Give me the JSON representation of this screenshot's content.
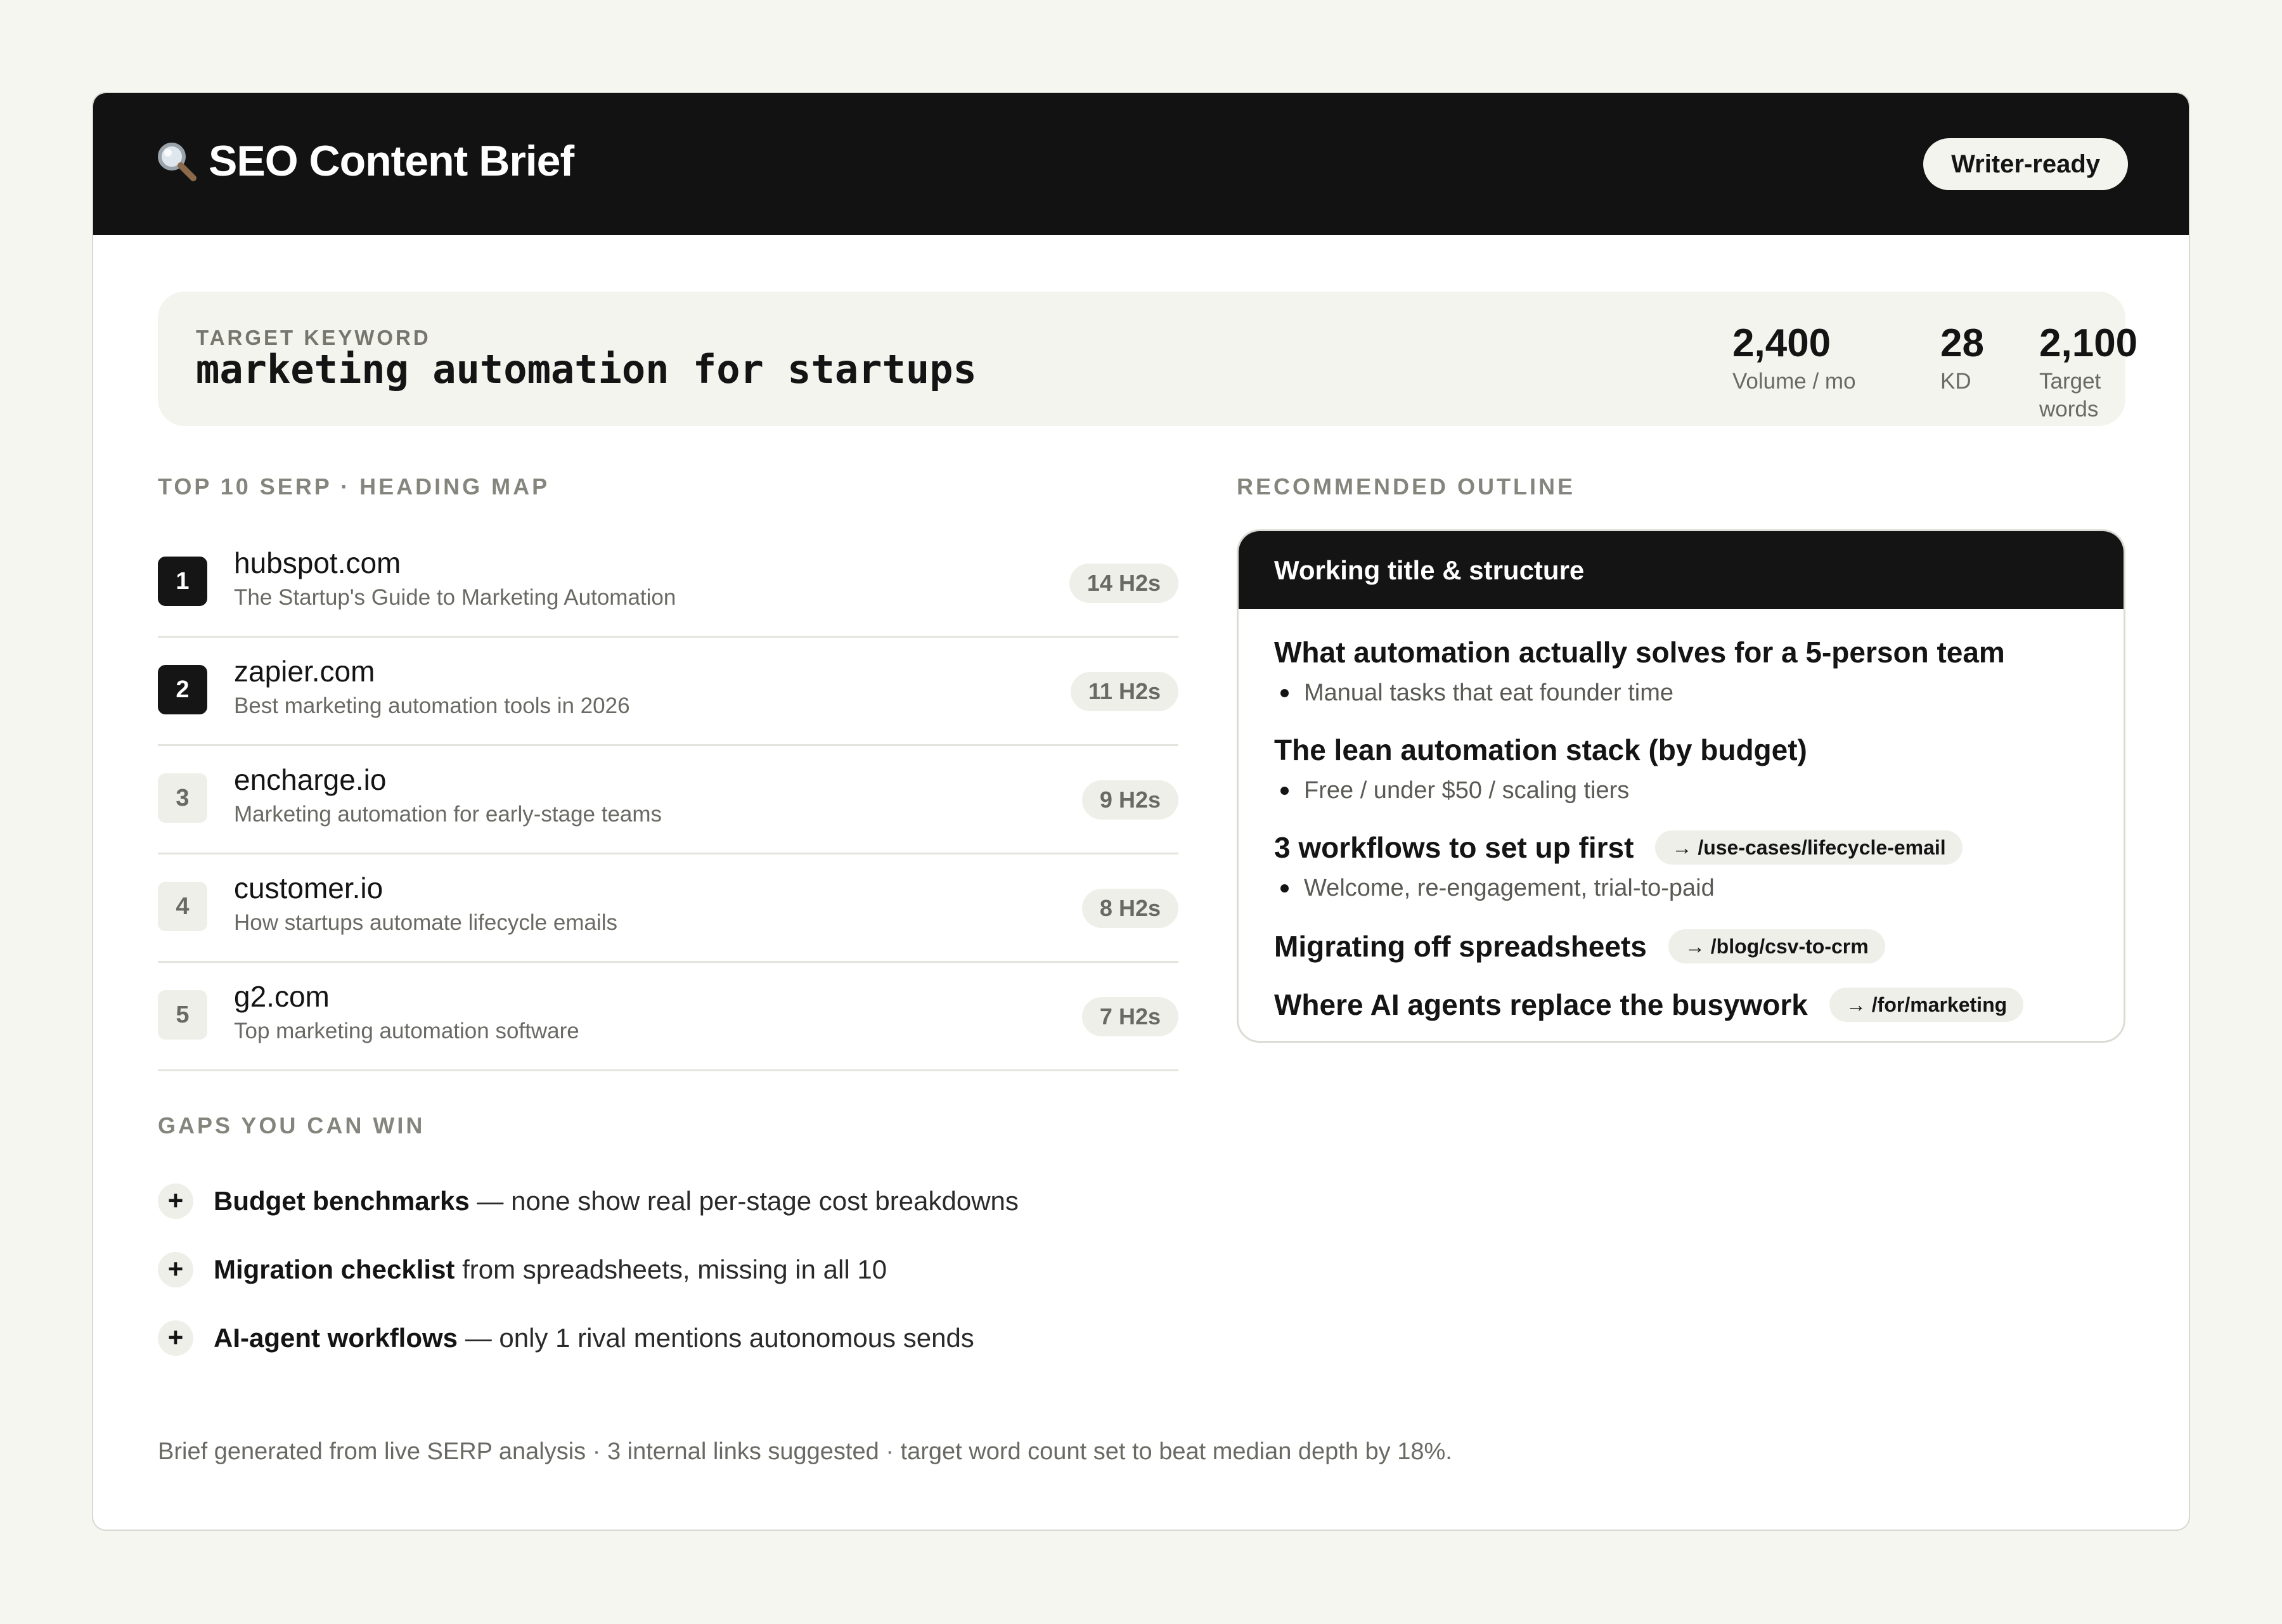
{
  "header": {
    "title": "SEO Content Brief",
    "icon": "magnifier-icon",
    "status_badge": "Writer-ready"
  },
  "keyword": {
    "label": "TARGET KEYWORD",
    "value": "marketing automation for startups",
    "metrics": [
      {
        "value": "2,400",
        "label": "Volume / mo"
      },
      {
        "value": "28",
        "label": "KD"
      },
      {
        "value": "2,100",
        "label": "Target words"
      }
    ]
  },
  "serp": {
    "section_label": "TOP 10 SERP · HEADING MAP",
    "rows": [
      {
        "rank": "1",
        "domain": "hubspot.com",
        "title": "The Startup's Guide to Marketing Automation",
        "h2s": "14 H2s",
        "highlight": true
      },
      {
        "rank": "2",
        "domain": "zapier.com",
        "title": "Best marketing automation tools in 2026",
        "h2s": "11 H2s",
        "highlight": true
      },
      {
        "rank": "3",
        "domain": "encharge.io",
        "title": "Marketing automation for early-stage teams",
        "h2s": "9 H2s",
        "highlight": false
      },
      {
        "rank": "4",
        "domain": "customer.io",
        "title": "How startups automate lifecycle emails",
        "h2s": "8 H2s",
        "highlight": false
      },
      {
        "rank": "5",
        "domain": "g2.com",
        "title": "Top marketing automation software",
        "h2s": "7 H2s",
        "highlight": false
      }
    ]
  },
  "gaps": {
    "section_label": "GAPS YOU CAN WIN",
    "items": [
      {
        "bold": "Budget benchmarks",
        "rest": " — none show real per-stage cost breakdowns"
      },
      {
        "bold": "Migration checklist",
        "rest": " from spreadsheets, missing in all 10"
      },
      {
        "bold": "AI-agent workflows",
        "rest": " — only 1 rival mentions autonomous sends"
      }
    ]
  },
  "outline": {
    "section_label": "RECOMMENDED OUTLINE",
    "head": "Working title & structure",
    "headings": [
      {
        "text": "What automation actually solves for a 5-person team",
        "sub": "Manual tasks that eat founder time",
        "link": ""
      },
      {
        "text": "The lean automation stack (by budget)",
        "sub": "Free / under $50 / scaling tiers",
        "link": ""
      },
      {
        "text": "3 workflows to set up first",
        "sub": "Welcome, re-engagement, trial-to-paid",
        "link": "→ /use-cases/lifecycle-email"
      },
      {
        "text": "Migrating off spreadsheets",
        "sub": "",
        "link": "→ /blog/csv-to-crm"
      },
      {
        "text": "Where AI agents replace the busywork",
        "sub": "",
        "link": "→ /for/marketing"
      }
    ]
  },
  "footer": {
    "note": "Brief generated from live SERP analysis · 3 internal links suggested · target word count set to beat median depth by 18%."
  }
}
